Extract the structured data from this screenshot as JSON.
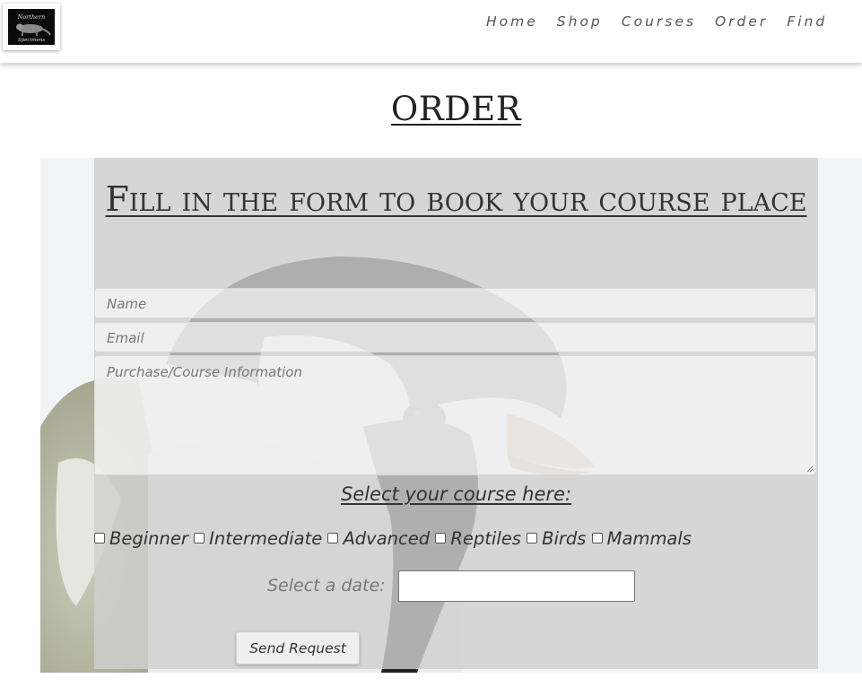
{
  "header": {
    "logo_text_top": "Northern",
    "logo_text_bottom": "Specimens",
    "nav": [
      "Home",
      "Shop",
      "Courses",
      "Order",
      "Find"
    ]
  },
  "page_title": "ORDER",
  "form": {
    "heading": "Fill in the form to book your course place",
    "name_placeholder": "Name",
    "email_placeholder": "Email",
    "info_placeholder": "Purchase/Course Information",
    "course_heading": "Select your course here:",
    "courses": [
      "Beginner",
      "Intermediate",
      "Advanced",
      "Reptiles",
      "Birds",
      "Mammals"
    ],
    "date_label": "Select a date:",
    "date_value": "",
    "submit_label": "Send Request"
  }
}
